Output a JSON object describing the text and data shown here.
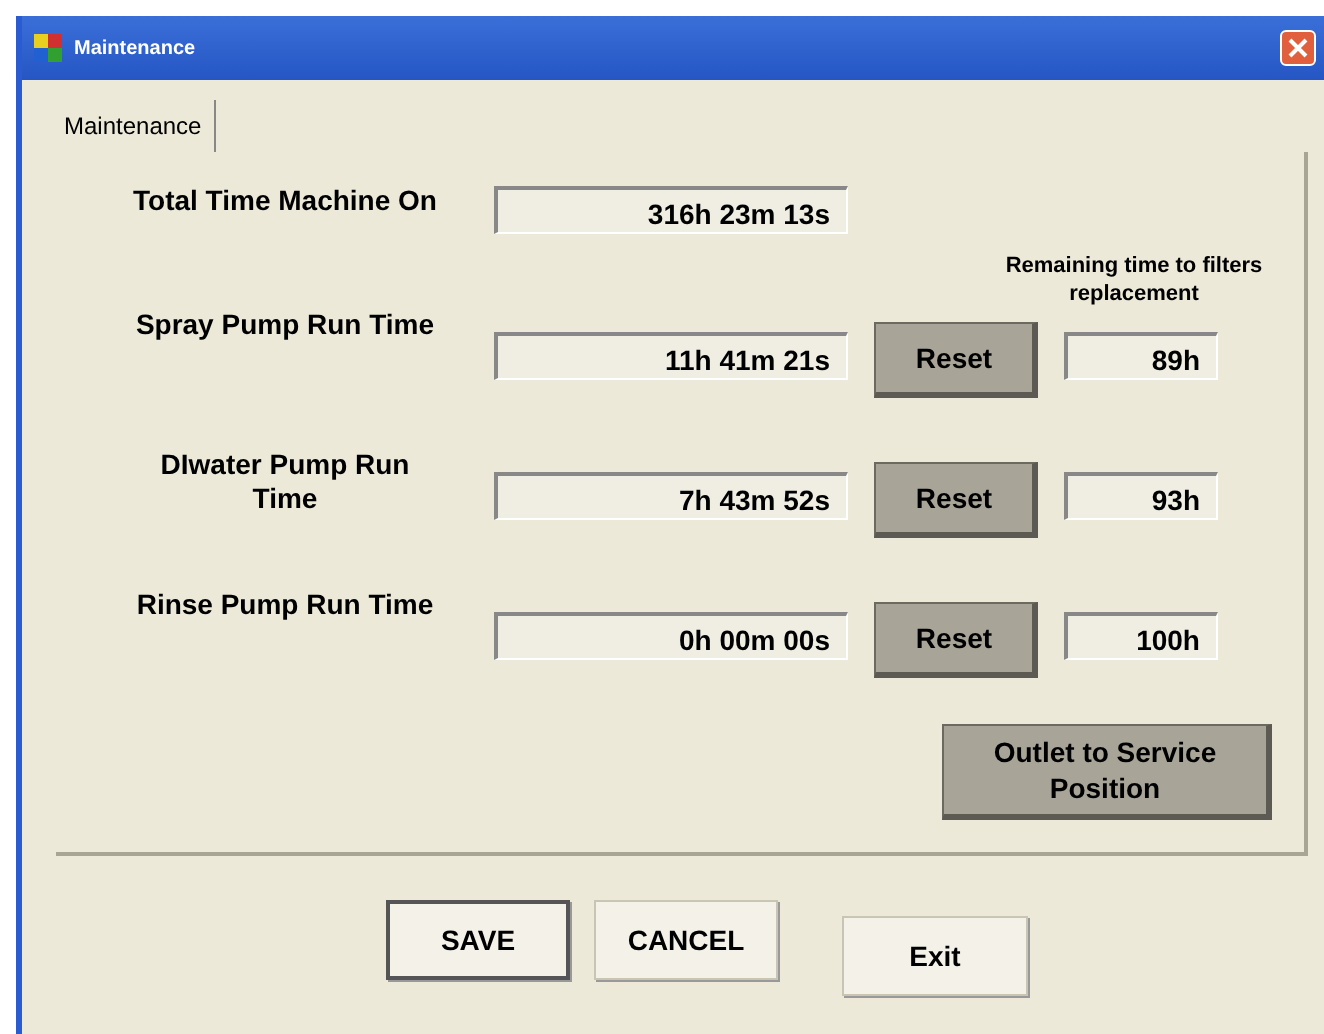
{
  "window": {
    "title": "Maintenance"
  },
  "tabs": [
    {
      "label": "Maintenance",
      "selected": true
    }
  ],
  "remaining_caption": "Remaining time to filters replacement",
  "rows": [
    {
      "kind": "total",
      "label": "Total Time Machine On",
      "value": "316h 23m 13s"
    },
    {
      "kind": "pump",
      "label": "Spray Pump Run Time",
      "value": "11h 41m 21s",
      "button": "Reset",
      "remaining": "89h"
    },
    {
      "kind": "pump",
      "label": "DIwater Pump Run Time",
      "value": "7h 43m 52s",
      "button": "Reset",
      "remaining": "93h"
    },
    {
      "kind": "pump",
      "label": "Rinse Pump Run Time",
      "value": "0h 00m 00s",
      "button": "Reset",
      "remaining": "100h"
    }
  ],
  "outlet_button": "Outlet to Service Position",
  "buttons": [
    {
      "label": "SAVE",
      "kind": "default"
    },
    {
      "label": "CANCEL",
      "kind": "plain"
    },
    {
      "label": "Exit",
      "kind": "plain"
    }
  ]
}
